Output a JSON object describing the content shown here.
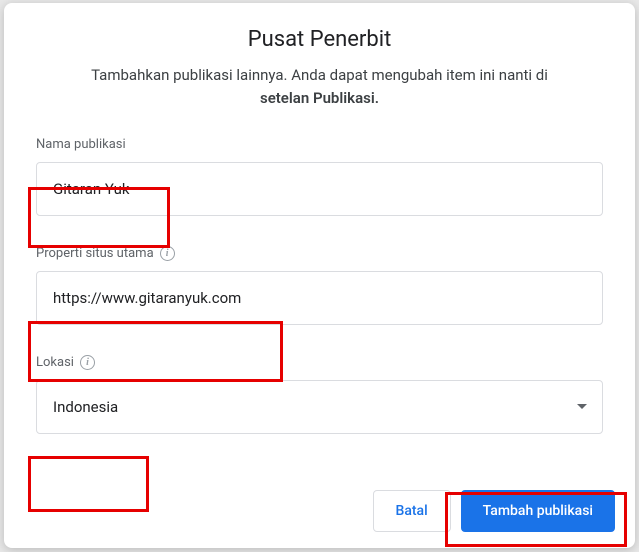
{
  "modal": {
    "title": "Pusat Penerbit",
    "subtitle_part1": "Tambahkan publikasi lainnya. Anda dapat mengubah item ini nanti di ",
    "subtitle_bold": "setelan Publikasi."
  },
  "form": {
    "publication_name": {
      "label": "Nama publikasi",
      "value": "Gitaran Yuk"
    },
    "primary_property": {
      "label": "Properti situs utama",
      "value": "https://www.gitaranyuk.com"
    },
    "location": {
      "label": "Lokasi",
      "value": "Indonesia"
    }
  },
  "footer": {
    "cancel": "Batal",
    "submit": "Tambah publikasi"
  }
}
